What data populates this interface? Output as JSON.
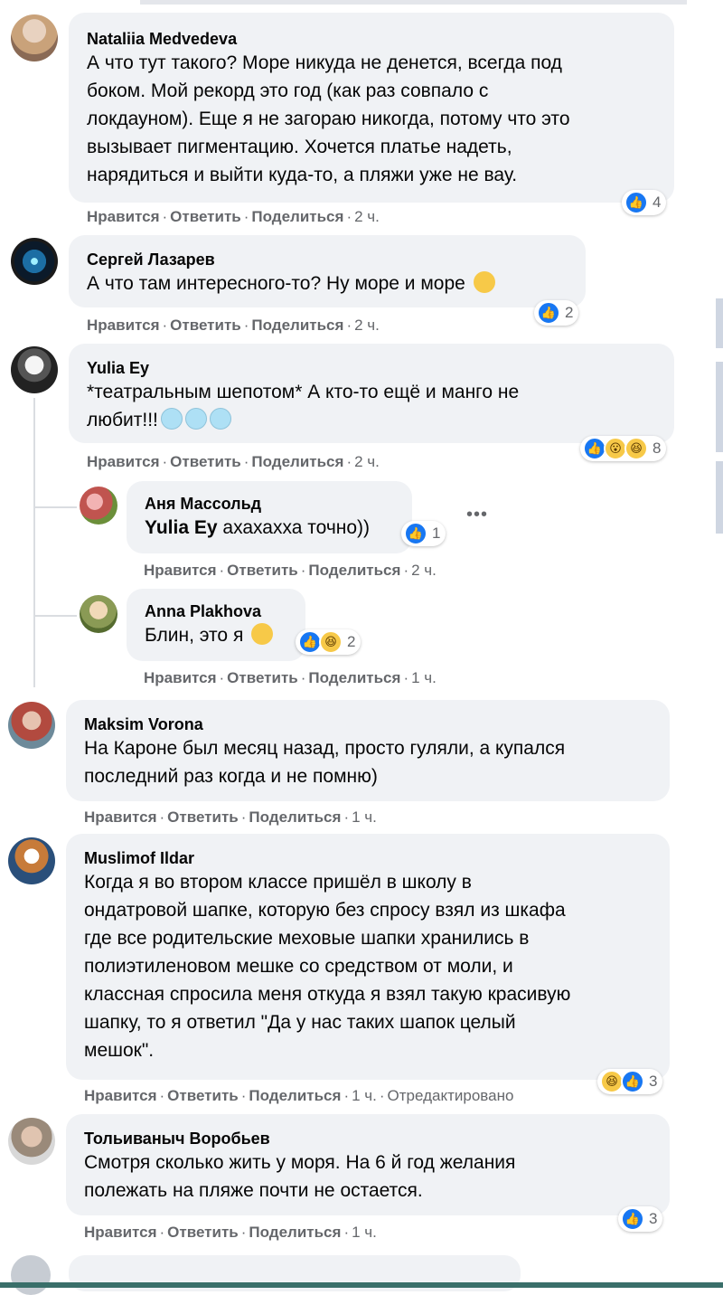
{
  "actions": {
    "like": "Нравится",
    "reply": "Ответить",
    "share": "Поделиться",
    "dot": "·",
    "edited": "Отредактировано"
  },
  "comments": [
    {
      "author": "Nataliia Medvedeva",
      "lines": [
        "А что тут такого? Море никуда не денется, всегда под",
        "боком. Мой рекорд это год (как раз совпало с",
        "локдауном). Еще я не загораю никогда, потому что это",
        "вызывает пигментацию. Хочется платье надеть,",
        "нарядиться и выйти куда-то, а пляжи уже не вау."
      ],
      "time": "2 ч.",
      "reactions": "4"
    },
    {
      "author": "Сергей Лазарев",
      "lines": [
        "А что там интересного-то? Ну море и море"
      ],
      "time": "2 ч.",
      "reactions": "2"
    },
    {
      "author": "Yulia Ey",
      "lines": [
        "*театральным шепотом* А кто-то ещё и манго не",
        "любит!!!"
      ],
      "time": "2 ч.",
      "reactions": "8"
    },
    {
      "author": "Аня Массольд",
      "mention": "Yulia Ey",
      "lines": [
        "ахахахха точно))"
      ],
      "time": "2 ч.",
      "reactions": "1"
    },
    {
      "author": "Anna Plakhova",
      "lines": [
        "Блин, это я"
      ],
      "time": "1 ч.",
      "reactions": "2"
    },
    {
      "author": "Maksim Vorona",
      "lines": [
        "На Кароне был месяц назад, просто гуляли, а купался",
        "последний раз когда и не помню)"
      ],
      "time": "1 ч."
    },
    {
      "author": "Muslimof Ildar",
      "lines": [
        "Когда я во втором классе пришёл в школу в",
        "ондатровой шапке, которую без спросу взял из шкафа",
        "где все родительские меховые шапки хранились в",
        "полиэтиленовом мешке со средством от моли, и",
        "классная спросила меня откуда я взял такую красивую",
        "шапку, то я ответил \"Да у нас таких шапок целый",
        "мешок\"."
      ],
      "time": "1 ч.",
      "reactions": "3"
    },
    {
      "author": "Тольиваныч Воробьев",
      "lines": [
        "Смотря сколько жить у моря. На 6 й год желания",
        "полежать на пляже почти не остается."
      ],
      "time": "1 ч.",
      "reactions": "3"
    }
  ],
  "colors": {
    "bubble": "#f0f2f5",
    "like_blue": "#1877f2",
    "meta_gray": "#65676b"
  }
}
